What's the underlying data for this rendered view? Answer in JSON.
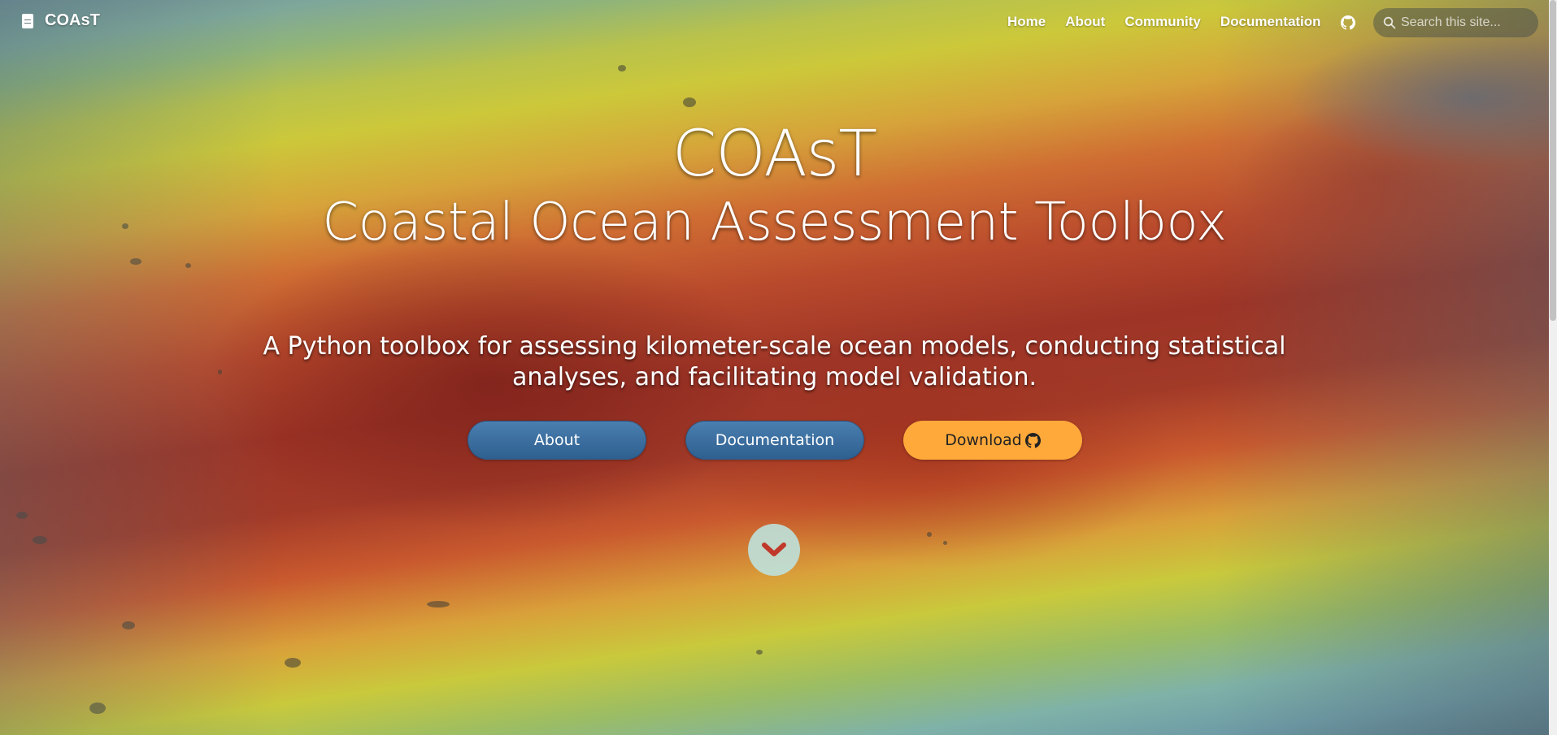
{
  "navbar": {
    "brand_name": "COAsT",
    "brand_icon": "document-icon",
    "links": [
      {
        "label": "Home"
      },
      {
        "label": "About"
      },
      {
        "label": "Community"
      },
      {
        "label": "Documentation"
      }
    ],
    "github_icon": "github-icon",
    "search": {
      "placeholder": "Search this site...",
      "value": "",
      "icon": "search-icon"
    }
  },
  "hero": {
    "title": "COAsT",
    "subtitle": "Coastal Ocean Assessment Toolbox",
    "lead": "A Python toolbox for assessing kilometer-scale ocean models, conducting statistical analyses, and facilitating model validation.",
    "buttons": {
      "about_label": "About",
      "docs_label": "Documentation",
      "download_label": "Download"
    },
    "scroll_icon": "chevron-down-icon"
  },
  "colors": {
    "button_blue": "#2e5f8f",
    "button_orange": "#ffa93a",
    "scroll_circle": "#bee1dc",
    "chevron": "#c0392b"
  }
}
